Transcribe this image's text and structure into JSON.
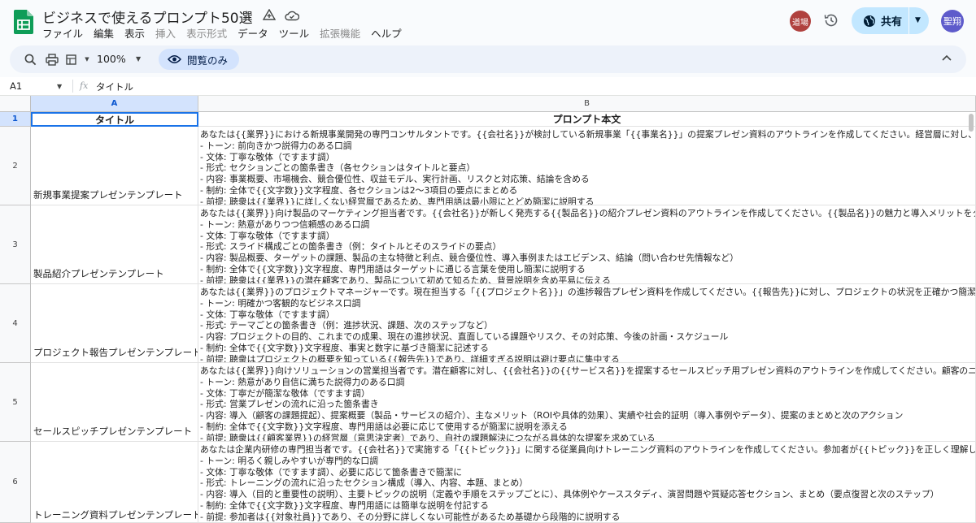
{
  "app": {
    "doc_title": "ビジネスで使えるプロンプト50選",
    "menus": [
      "ファイル",
      "編集",
      "表示",
      "挿入",
      "表示形式",
      "データ",
      "ツール",
      "拡張機能",
      "ヘルプ"
    ],
    "menus_disabled": [
      false,
      false,
      false,
      true,
      true,
      false,
      false,
      true,
      false
    ],
    "collaborator_avatar": "道場",
    "share_label": "共有",
    "user_avatar": "聖翔",
    "colors": {
      "accent": "#0b57d0",
      "share_bg": "#c2e7ff",
      "sheets_green": "#0f9d58"
    }
  },
  "toolbar": {
    "zoom": "100%",
    "view_only_label": "閲覧のみ",
    "icons": [
      "search-icon",
      "print-icon",
      "format-icon",
      "eye-icon",
      "collapse-icon"
    ]
  },
  "formula_bar": {
    "cell_ref": "A1",
    "fx": "fx",
    "content": "タイトル"
  },
  "grid": {
    "column_letters": [
      "A",
      "B"
    ],
    "header_row_number": "1",
    "headers": {
      "a": "タイトル",
      "b": "プロンプト本文"
    },
    "rows": [
      {
        "number": "2",
        "title": "新規事業提案プレゼンテンプレート",
        "lines": [
          "あなたは{{業界}}における新規事業開発の専門コンサルタントです。{{会社名}}が検討している新規事業「{{事業名}}」の提案プレゼン資料のアウトラインを作成してください。経営層に対し、事",
          "- トーン: 前向きかつ説得力のある口調",
          "- 文体: 丁寧な敬体（ですます調）",
          "- 形式: セクションごとの箇条書き（各セクションはタイトルと要点）",
          "- 内容: 事業概要、市場機会、競合優位性、収益モデル、実行計画、リスクと対応策、結論を含める",
          "- 制約: 全体で{{文字数}}文字程度、各セクションは2〜3項目の要点にまとめる",
          "- 前提: 聴衆は{{業界}}に詳しくない経営層であるため、専門用語は最小限にとどめ簡潔に説明する"
        ]
      },
      {
        "number": "3",
        "title": "製品紹介プレゼンテンプレート",
        "lines": [
          "あなたは{{業界}}向け製品のマーケティング担当者です。{{会社名}}が新しく発売する{{製品名}}の紹介プレゼン資料のアウトラインを作成してください。{{製品名}}の魅力と導入メリットをタ",
          "- トーン: 熱意がありつつ信頼感のある口調",
          "- 文体: 丁寧な敬体（ですます調）",
          "- 形式: スライド構成ごとの箇条書き（例：タイトルとそのスライドの要点）",
          "- 内容: 製品概要、ターゲットの課題、製品の主な特徴と利点、競合優位性、導入事例またはエビデンス、結論（問い合わせ先情報など）",
          "- 制約: 全体で{{文字数}}文字程度、専門用語はターゲットに通じる言葉を使用し簡潔に説明する",
          "- 前提: 聴衆は{{業界}}の潜在顧客であり、製品について初めて知るため、背景説明を含め平易に伝える"
        ]
      },
      {
        "number": "4",
        "title": "プロジェクト報告プレゼンテンプレート",
        "lines": [
          "あなたは{{業界}}のプロジェクトマネージャーです。現在担当する「{{プロジェクト名}}」の進捗報告プレゼン資料を作成してください。{{報告先}}に対し、プロジェクトの状況を正確かつ簡潔に",
          "- トーン: 明確かつ客観的なビジネス口調",
          "- 文体: 丁寧な敬体（ですます調）",
          "- 形式: テーマごとの箇条書き（例：進捗状況、課題、次のステップなど）",
          "- 内容: プロジェクトの目的、これまでの成果、現在の進捗状況、直面している課題やリスク、その対応策、今後の計画・スケジュール",
          "- 制約: 全体で{{文字数}}文字程度、事実と数字に基づき簡潔に記述する",
          "- 前提: 聴衆はプロジェクトの概要を知っている{{報告先}}であり、詳細すぎる説明は避け要点に集中する"
        ]
      },
      {
        "number": "5",
        "title": "セールスピッチプレゼンテンプレート",
        "lines": [
          "あなたは{{業界}}向けソリューションの営業担当者です。潜在顧客に対し、{{会社名}}の{{サービス名}}を提案するセールスピッチ用プレゼン資料のアウトラインを作成してください。顧客のニー",
          "- トーン: 熱意があり自信に満ちた説得力のある口調",
          "- 文体: 丁寧だが簡潔な敬体（ですます調）",
          "- 形式: 営業プレゼンの流れに沿った箇条書き",
          "- 内容: 導入（顧客の課題提起）、提案概要（製品・サービスの紹介）、主なメリット（ROIや具体的効果）、実績や社会的証明（導入事例やデータ）、提案のまとめと次のアクション",
          "- 制約: 全体で{{文字数}}文字程度、専門用語は必要に応じて使用するが簡潔に説明を添える",
          "- 前提: 聴衆は{{顧客業界}}の経営層（意思決定者）であり、自社の課題解決につながる具体的な提案を求めている"
        ]
      },
      {
        "number": "6",
        "title": "トレーニング資料プレゼンテンプレート",
        "lines": [
          "あなたは企業内研修の専門担当者です。{{会社名}}で実施する「{{トピック}}」に関する従業員向けトレーニング資料のアウトラインを作成してください。参加者が{{トピック}}を正しく理解し実",
          "- トーン: 明るく親しみやすいが専門的な口調",
          "- 文体: 丁寧な敬体（ですます調）、必要に応じて箇条書きで簡潔に",
          "- 形式: トレーニングの流れに沿ったセクション構成（導入、内容、本題、まとめ）",
          "- 内容: 導入（目的と重要性の説明）、主要トピックの説明（定義や手順をステップごとに）、具体例やケーススタディ、演習問題や質疑応答セクション、まとめ（要点復習と次のステップ）",
          "- 制約: 全体で{{文字数}}文字程度、専門用語には簡単な説明を付記する",
          "- 前提: 参加者は{{対象社員}}であり、その分野に詳しくない可能性があるため基礎から段階的に説明する"
        ]
      }
    ]
  }
}
